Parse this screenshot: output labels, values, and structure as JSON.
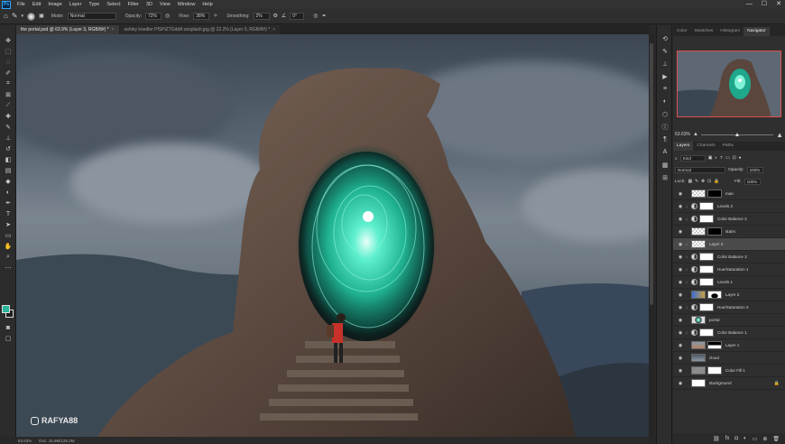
{
  "menubar": {
    "logo": "Ps",
    "items": [
      "File",
      "Edit",
      "Image",
      "Layer",
      "Type",
      "Select",
      "Filter",
      "3D",
      "View",
      "Window",
      "Help"
    ],
    "window_controls": [
      "—",
      "☐",
      "✕"
    ]
  },
  "options": {
    "mode_label": "Mode:",
    "mode_value": "Normal",
    "opacity_label": "Opacity:",
    "opacity_value": "72%",
    "flow_label": "Flow:",
    "flow_value": "38%",
    "smoothing_label": "Smoothing:",
    "smoothing_value": "2%",
    "angle_value": "0°"
  },
  "tabs": [
    {
      "label": "the portal.psd @ 63.9% (Layer 3, RGB/8#) *",
      "active": true
    },
    {
      "label": "ashley knedler PfSPiZTGddA unsplash.jpg @ 22.2% (Layer 0, RGB/8#) *",
      "active": false
    }
  ],
  "status": {
    "zoom": "63.63%",
    "doc": "Doc: 15.9M/126.2M"
  },
  "watermark": "RAFYA88",
  "panel_tabs": [
    "Color",
    "Swatches",
    "Histogram",
    "Navigator"
  ],
  "navigator": {
    "zoom": "63.63%"
  },
  "layers_panel": {
    "tabs": [
      "Layers",
      "Channels",
      "Paths"
    ],
    "kind_label": "Kind",
    "blend_mode": "Normal",
    "opacity_label": "Opacity:",
    "opacity_value": "100%",
    "lock_label": "Lock:",
    "fill_label": "Fill:",
    "fill_value": "100%",
    "layers": [
      {
        "name": "man",
        "selected": false,
        "thumb": "photo",
        "mask": "black",
        "clipped": false
      },
      {
        "name": "Levels 2",
        "selected": false,
        "thumb": "adj",
        "mask": "white",
        "clipped": true
      },
      {
        "name": "Color Balance 2",
        "selected": false,
        "thumb": "adj",
        "mask": "white",
        "clipped": true
      },
      {
        "name": "stairs",
        "selected": false,
        "thumb": "photo",
        "mask": "black",
        "clipped": false
      },
      {
        "name": "Layer 3",
        "selected": true,
        "thumb": "trans",
        "mask": "none",
        "clipped": true
      },
      {
        "name": "Color Balance 3",
        "selected": false,
        "thumb": "adj",
        "mask": "white",
        "clipped": true
      },
      {
        "name": "Hue/Saturation 1",
        "selected": false,
        "thumb": "adj",
        "mask": "white",
        "clipped": true
      },
      {
        "name": "Levels 1",
        "selected": false,
        "thumb": "adj",
        "mask": "white",
        "clipped": true
      },
      {
        "name": "Layer 2",
        "selected": false,
        "thumb": "color",
        "mask": "arch",
        "clipped": false
      },
      {
        "name": "Hue/Saturation 3",
        "selected": false,
        "thumb": "adj",
        "mask": "white",
        "clipped": true
      },
      {
        "name": "portal",
        "selected": false,
        "thumb": "portal",
        "mask": "none",
        "clipped": false
      },
      {
        "name": "Color Balance 1",
        "selected": false,
        "thumb": "adj",
        "mask": "white",
        "clipped": true
      },
      {
        "name": "Layer 1",
        "selected": false,
        "thumb": "photo",
        "mask": "black",
        "clipped": false
      },
      {
        "name": "cloud",
        "selected": false,
        "thumb": "sky",
        "mask": "none",
        "clipped": false
      },
      {
        "name": "Color Fill 1",
        "selected": false,
        "thumb": "gray",
        "mask": "white",
        "clipped": false
      },
      {
        "name": "Background",
        "selected": false,
        "thumb": "white",
        "mask": "none",
        "clipped": false
      }
    ]
  }
}
